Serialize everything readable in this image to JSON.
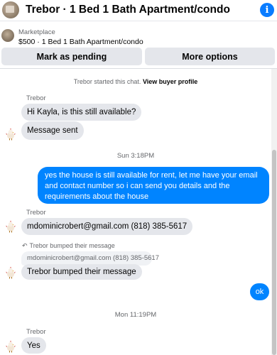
{
  "header": {
    "title": "Trebor · 1 Bed 1 Bath Apartment/condo",
    "info_icon": "info-icon"
  },
  "listing": {
    "label": "Marketplace",
    "detail": "$500 · 1 Bed 1 Bath Apartment/condo"
  },
  "actions": {
    "pending_label": "Mark as pending",
    "more_label": "More options"
  },
  "chat": {
    "system_note": "Trebor started this chat.",
    "view_profile_link": "View buyer profile",
    "groups": [
      {
        "sender": "Trebor",
        "messages": [
          "Hi Kayla, is this still available?",
          "Message sent"
        ]
      },
      {
        "timestamp": "Sun 3:18PM",
        "outgoing": "yes the house is still available for rent, let me have your email  and contact number so i can send you details and the requirements about the house"
      },
      {
        "sender": "Trebor",
        "messages": [
          "mdominicrobert@gmail.com (818) 385-5617"
        ]
      },
      {
        "reply_note": "Trebor bumped their message",
        "quoted": "mdominicrobert@gmail.com (818) 385-5617",
        "messages": [
          "Trebor bumped their message"
        ]
      },
      {
        "outgoing": "ok"
      },
      {
        "timestamp": "Mon 11:19PM",
        "sender": "Trebor",
        "messages": [
          "Yes"
        ]
      }
    ]
  },
  "colors": {
    "outgoing_bubble": "#0084ff",
    "incoming_bubble": "#e4e6eb",
    "button_bg": "#e4e6eb",
    "accent": "#0a7cff"
  }
}
